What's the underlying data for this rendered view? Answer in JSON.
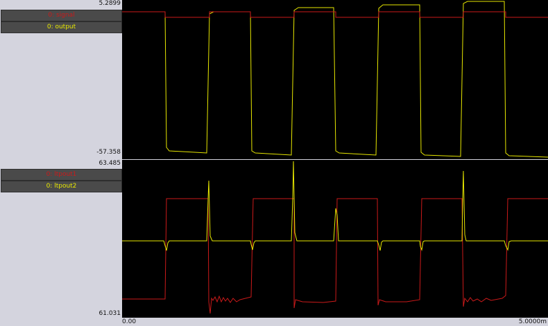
{
  "panels": [
    {
      "ymax": "5.2899",
      "ymin": "-57.358",
      "traces": [
        {
          "label": "0: signal",
          "color": "#cc1a1a"
        },
        {
          "label": "0: output",
          "color": "#e8e800"
        }
      ]
    },
    {
      "ymax": "63.485",
      "ymin": "61.031",
      "traces": [
        {
          "label": "0: ltpout1",
          "color": "#cc1a1a"
        },
        {
          "label": "0: ltpout2",
          "color": "#e8e800"
        }
      ]
    }
  ],
  "xaxis": {
    "start": "0.00",
    "end": "5.0000m"
  },
  "colors": {
    "background": "#d4d4de",
    "plot": "#000000",
    "red": "#cc1a1a",
    "yellow": "#e8e800"
  }
}
